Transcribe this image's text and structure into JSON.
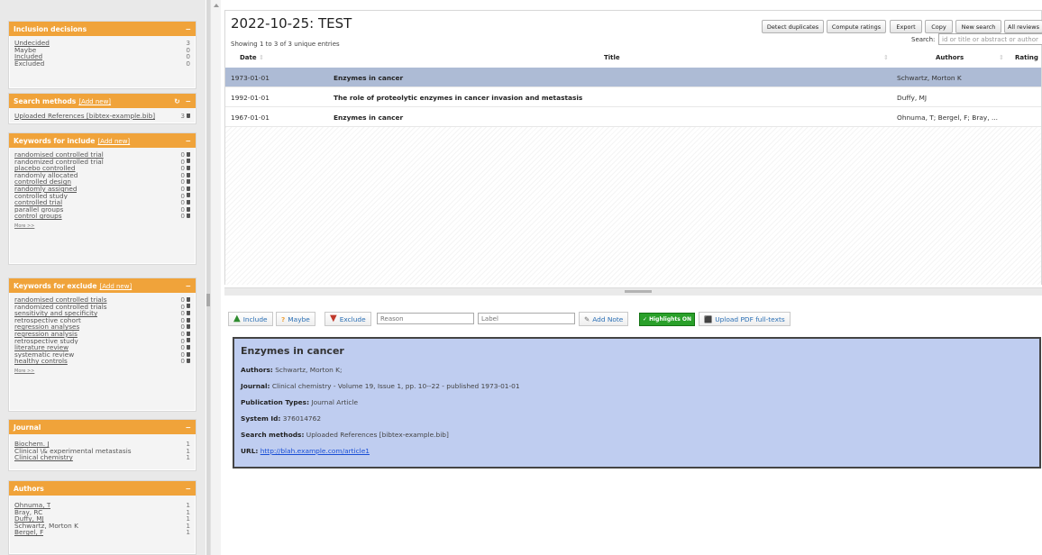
{
  "sidebar": {
    "inclusion": {
      "title": "Inclusion decisions",
      "collapse": "−",
      "items": [
        {
          "label": "Undecided",
          "count": "3"
        },
        {
          "label": "Maybe",
          "count": "0"
        },
        {
          "label": "Included",
          "count": "0"
        },
        {
          "label": "Excluded",
          "count": "0"
        }
      ]
    },
    "search_methods": {
      "title": "Search methods",
      "add": "[Add new]",
      "refresh": "↻",
      "collapse": "−",
      "items": [
        {
          "label": "Uploaded References [bibtex-example.bib]",
          "count": "3"
        }
      ]
    },
    "keywords_include": {
      "title": "Keywords for include",
      "add": "[Add new]",
      "collapse": "−",
      "more": "More >>",
      "items": [
        {
          "label": "randomised controlled trial",
          "count": "0"
        },
        {
          "label": "randomized controlled trial",
          "count": "0"
        },
        {
          "label": "placebo controlled",
          "count": "0"
        },
        {
          "label": "randomly allocated",
          "count": "0"
        },
        {
          "label": "controlled design",
          "count": "0"
        },
        {
          "label": "randomly assigned",
          "count": "0"
        },
        {
          "label": "controlled study",
          "count": "0"
        },
        {
          "label": "controlled trial",
          "count": "0"
        },
        {
          "label": "parallel groups",
          "count": "0"
        },
        {
          "label": "control groups",
          "count": "0"
        }
      ]
    },
    "keywords_exclude": {
      "title": "Keywords for exclude",
      "add": "[Add new]",
      "collapse": "−",
      "more": "More >>",
      "items": [
        {
          "label": "randomised controlled trials",
          "count": "0"
        },
        {
          "label": "randomized controlled trials",
          "count": "0"
        },
        {
          "label": "sensitivity and specificity",
          "count": "0"
        },
        {
          "label": "retrospective cohort",
          "count": "0"
        },
        {
          "label": "regression analyses",
          "count": "0"
        },
        {
          "label": "regression analysis",
          "count": "0"
        },
        {
          "label": "retrospective study",
          "count": "0"
        },
        {
          "label": "literature review",
          "count": "0"
        },
        {
          "label": "systematic review",
          "count": "0"
        },
        {
          "label": "healthy controls",
          "count": "0"
        }
      ]
    },
    "journal": {
      "title": "Journal",
      "collapse": "−",
      "items": [
        {
          "label": "Biochem. J",
          "count": "1"
        },
        {
          "label": "Clinical \\& experimental metastasis",
          "count": "1"
        },
        {
          "label": "Clinical chemistry",
          "count": "1"
        }
      ]
    },
    "authors": {
      "title": "Authors",
      "collapse": "−",
      "items": [
        {
          "label": "Ohnuma, T",
          "count": "1"
        },
        {
          "label": "Bray, RC",
          "count": "1"
        },
        {
          "label": "Duffy, MJ",
          "count": "1"
        },
        {
          "label": "Schwartz, Morton K",
          "count": "1"
        },
        {
          "label": "Bergel, F",
          "count": "1"
        }
      ]
    }
  },
  "header": {
    "title": "2022-10-25: TEST",
    "showing": "Showing 1 to 3 of 3 unique entries",
    "buttons": {
      "detect": "Detect duplicates",
      "compute": "Compute ratings",
      "export": "Export",
      "copy": "Copy",
      "new_search": "New search",
      "all_reviews": "All reviews"
    },
    "search_label": "Search:",
    "search_placeholder": "id or title or abstract or author"
  },
  "table": {
    "columns": {
      "date": "Date",
      "title": "Title",
      "authors": "Authors",
      "rating": "Rating"
    },
    "sort_glyph": "⇕",
    "rows": [
      {
        "date": "1973-01-01",
        "title": "Enzymes in cancer",
        "authors": "Schwartz, Morton K"
      },
      {
        "date": "1992-01-01",
        "title": "The role of proteolytic enzymes in cancer invasion and metastasis",
        "authors": "Duffy, MJ"
      },
      {
        "date": "1967-01-01",
        "title": "Enzymes in cancer",
        "authors": "Ohnuma, T; Bergel, F; Bray, ..."
      }
    ]
  },
  "actions": {
    "include": "Include",
    "maybe": "Maybe",
    "exclude": "Exclude",
    "reason_placeholder": "Reason",
    "label_placeholder": "Label",
    "add_note": "Add Note",
    "highlights": "✓ Highlights ON",
    "upload": "Upload PDF full-texts"
  },
  "detail": {
    "title": "Enzymes in cancer",
    "authors_label": "Authors:",
    "authors": "Schwartz, Morton K;",
    "journal_label": "Journal:",
    "journal": "Clinical chemistry - Volume 19, Issue 1, pp. 10--22 - published 1973-01-01",
    "pubtypes_label": "Publication Types:",
    "pubtypes": "Journal Article",
    "sysid_label": "System Id:",
    "sysid": "376014762",
    "methods_label": "Search methods:",
    "methods": "Uploaded References [bibtex-example.bib]",
    "url_label": "URL:",
    "url": "http://blah.example.com/article1"
  },
  "colors": {
    "panel_header": "#f0a33a",
    "selected_row": "#adbbd5",
    "detail_bg": "#bfcdf0",
    "highlight_btn": "#2aa02a"
  }
}
